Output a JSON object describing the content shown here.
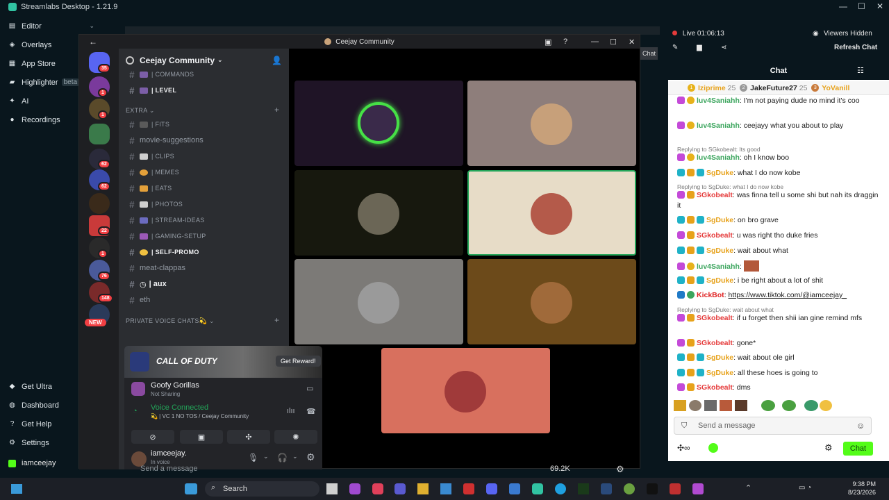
{
  "app": {
    "title": "Streamlabs Desktop - 1.21.9"
  },
  "nav": {
    "items": [
      {
        "label": "Editor",
        "icon": "editor-icon"
      },
      {
        "label": "Overlays",
        "icon": "overlays-icon"
      },
      {
        "label": "App Store",
        "icon": "app-store-icon"
      },
      {
        "label": "Highlighter",
        "icon": "highlighter-icon",
        "badge": "beta"
      },
      {
        "label": "AI",
        "icon": "ai-icon"
      },
      {
        "label": "Recordings",
        "icon": "recordings-icon"
      }
    ],
    "bottom": [
      {
        "label": "Get Ultra",
        "icon": "ultra-icon"
      },
      {
        "label": "Dashboard",
        "icon": "dashboard-icon"
      },
      {
        "label": "Get Help",
        "icon": "help-icon"
      },
      {
        "label": "Settings",
        "icon": "settings-icon"
      }
    ],
    "user": "iamceejay"
  },
  "discord": {
    "window_title": "Ceejay Community",
    "guild_name": "Ceejay Community",
    "server_badges": [
      "35",
      "1",
      "1",
      "",
      "62",
      "62",
      "",
      "22",
      "1",
      "76",
      "148",
      ""
    ],
    "new_label": "NEW",
    "channels_top": [
      {
        "name": "| COMMANDS",
        "style": "muted"
      },
      {
        "name": "| LEVEL",
        "style": "bold"
      }
    ],
    "category_extra": "EXTRA",
    "channels_extra": [
      {
        "name": "| FITS"
      },
      {
        "name": "movie-suggestions",
        "big": true
      },
      {
        "name": "| CLIPS"
      },
      {
        "name": "| MEMES"
      },
      {
        "name": "| EATS"
      },
      {
        "name": "| PHOTOS"
      },
      {
        "name": "| STREAM-IDEAS"
      },
      {
        "name": "| GAMING-SETUP"
      },
      {
        "name": "| SELF-PROMO",
        "bold": true
      },
      {
        "name": "meat-clappas",
        "big": true
      },
      {
        "name": "| aux",
        "big": true,
        "bold": true
      },
      {
        "name": "eth",
        "big": true
      }
    ],
    "category_private": "PRIVATE VOICE CHATS💫",
    "banner_game": "CALL OF DUTY",
    "banner_button": "Get Reward!",
    "activity_name": "Goofy Gorillas",
    "activity_status": "Not Sharing",
    "voice_status": "Voice Connected",
    "voice_channel": "💫 | VC 1 NO TOS / Ceejay Community",
    "username": "iamceejay.",
    "user_status": "In voice",
    "message_placeholder": "Send a message",
    "viewer_count": "69.2K"
  },
  "stream": {
    "live_label": "Live",
    "live_time": "01:06:13",
    "viewers_hidden": "Viewers Hidden",
    "refresh_chat": "Refresh Chat"
  },
  "chat": {
    "title": "Chat",
    "leaderboard": [
      {
        "rank": "1",
        "name": "Iziprime",
        "score": "25"
      },
      {
        "rank": "2",
        "name": "JakeFuture27",
        "score": "25"
      },
      {
        "rank": "3",
        "name": "YoVanill",
        "score": ""
      }
    ],
    "messages": [
      {
        "name": "luv4Saniahh",
        "text": ": I'm not paying dude no mind it's coo",
        "cls": "name-luv"
      },
      {
        "name": "luv4Saniahh",
        "text": ": ceejayy what you about to play",
        "cls": "name-luv"
      },
      {
        "reply": "Replying to SGkobealt: Its good"
      },
      {
        "name": "luv4Saniahh",
        "text": ": oh I know boo",
        "cls": "name-luv"
      },
      {
        "name": "SgDuke",
        "text": ": what I do now kobe",
        "cls": "name-duke"
      },
      {
        "reply": "Replying to SgDuke: what I do now kobe"
      },
      {
        "name": "SGkobealt",
        "text": ": was finna tell u some shi but nah its draggin it",
        "cls": "name-sgk"
      },
      {
        "name": "SgDuke",
        "text": ": on bro grave",
        "cls": "name-duke"
      },
      {
        "name": "SGkobealt",
        "text": ": u was right tho duke fries",
        "cls": "name-sgk"
      },
      {
        "name": "SgDuke",
        "text": ": wait about what",
        "cls": "name-duke"
      },
      {
        "name": "luv4Saniahh",
        "text": ":",
        "cls": "name-luv"
      },
      {
        "name": "SgDuke",
        "text": ": i be right about a lot of shit",
        "cls": "name-duke"
      },
      {
        "name": "KickBot",
        "text": ": ",
        "link": "https://www.tiktok.com/@iamceejay_",
        "cls": "name-kick"
      },
      {
        "reply": "Replying to SgDuke: wait about what"
      },
      {
        "name": "SGkobealt",
        "text": ": if u forget then shii ian gine remind mfs",
        "cls": "name-sgk"
      },
      {
        "name": "SGkobealt",
        "text": ": gone*",
        "cls": "name-sgk"
      },
      {
        "name": "SgDuke",
        "text": ": wait about ole girl",
        "cls": "name-duke"
      },
      {
        "name": "SgDuke",
        "text": ": all these hoes is going to",
        "cls": "name-duke"
      },
      {
        "name": "SGkobealt",
        "text": ": dms",
        "cls": "name-sgk"
      }
    ],
    "send_placeholder": "Send a message",
    "chat_button": "Chat"
  },
  "taskbar": {
    "search_label": "Search",
    "time": "9:38 PM",
    "date": "8/23/2026"
  },
  "colors": {
    "kick_green": "#53fc18",
    "discord_bg": "#2b2d31",
    "voice_green": "#23a559"
  }
}
